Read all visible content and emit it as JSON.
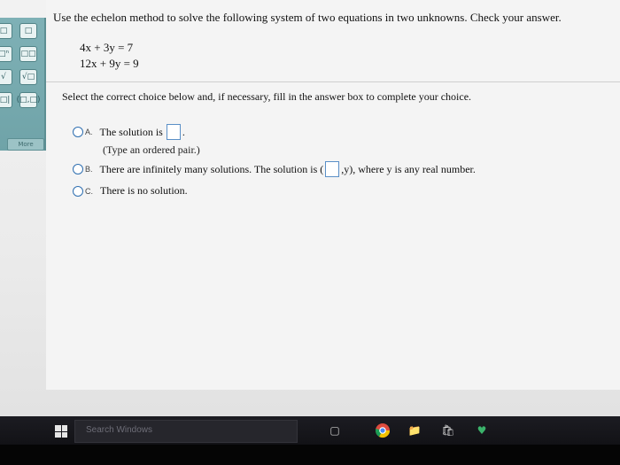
{
  "question": {
    "prompt": "Use the echelon method to solve the following system of two equations in two unknowns. Check your answer.",
    "equations": [
      "4x + 3y = 7",
      "12x + 9y = 9"
    ]
  },
  "instruction": "Select the correct choice below and, if necessary, fill in the answer box to complete your choice.",
  "choices": [
    {
      "letter": "A.",
      "text_before": "The solution is",
      "text_after": ".",
      "hint": "(Type an ordered pair.)"
    },
    {
      "letter": "B.",
      "text_before": "There are infinitely many solutions. The solution is (",
      "text_after": ",y), where y is any real number."
    },
    {
      "letter": "C.",
      "text": "There is no solution."
    }
  ],
  "palette": {
    "more_label": "More",
    "buttons": [
      "□",
      "□",
      "□ⁿ",
      "□□",
      "√",
      "√□",
      "|□|",
      "(□,□)"
    ]
  },
  "taskbar": {
    "search_placeholder": "Search Windows"
  }
}
